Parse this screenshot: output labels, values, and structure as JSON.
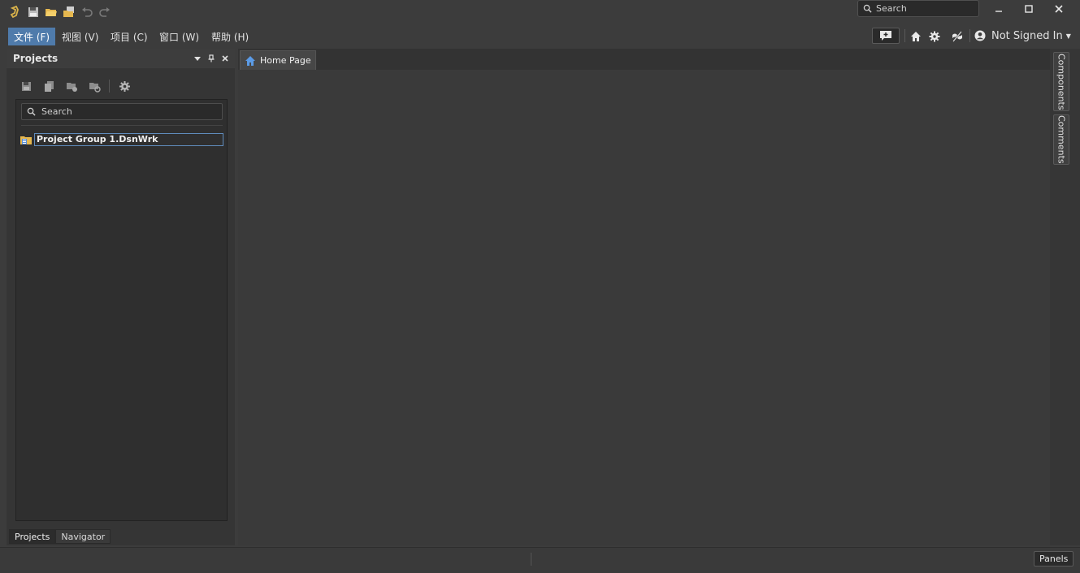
{
  "titlebar": {
    "search_placeholder": "Search",
    "quick_access": [
      "app-logo-icon",
      "save-icon",
      "open-folder-icon",
      "open-project-icon",
      "undo-icon",
      "redo-icon"
    ]
  },
  "menu": {
    "items": [
      "文件 (F)",
      "视图 (V)",
      "项目 (C)",
      "窗口 (W)",
      "帮助 (H)"
    ],
    "active_index": 0
  },
  "user": {
    "label": "Not Signed In"
  },
  "projects_panel": {
    "title": "Projects",
    "search_placeholder": "Search",
    "tree": [
      {
        "label": "Project Group 1.DsnWrk"
      }
    ],
    "tabs": [
      "Projects",
      "Navigator"
    ],
    "active_tab": 0
  },
  "document": {
    "tabs": [
      "Home Page"
    ]
  },
  "side_panels": [
    "Components",
    "Comments"
  ],
  "statusbar": {
    "panels_label": "Panels"
  },
  "colors": {
    "accent": "#4f7bab",
    "background": "#3a3a3a",
    "panel": "#2f2f2f"
  }
}
